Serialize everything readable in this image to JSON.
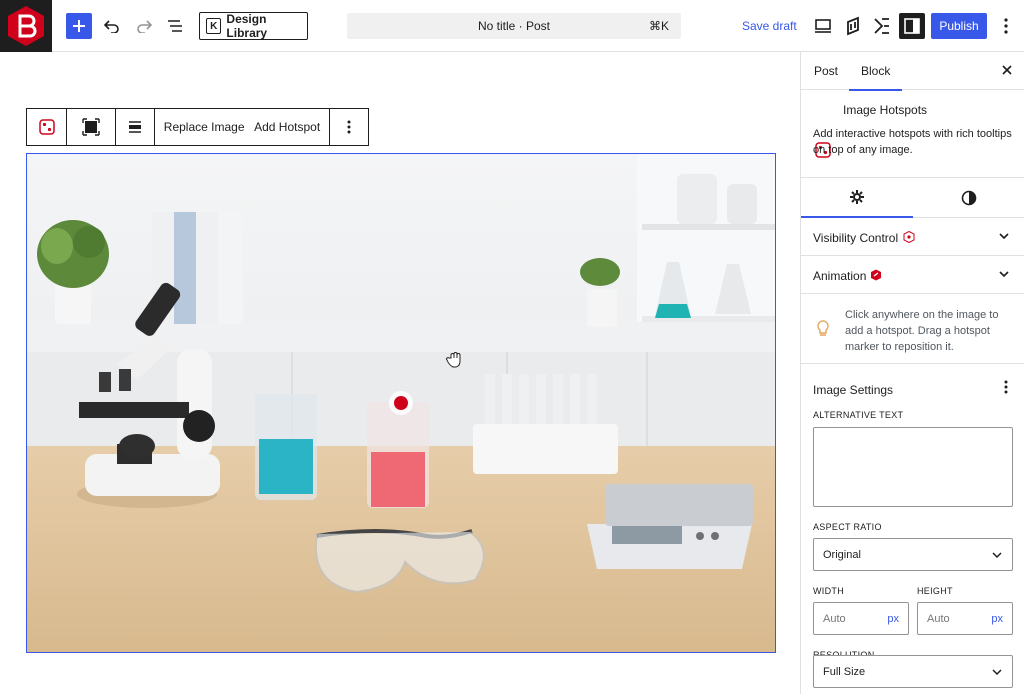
{
  "topbar": {
    "design_library_label": "Design Library",
    "document_title": "No title · Post",
    "shortcut": "⌘K",
    "save_draft_label": "Save draft",
    "publish_label": "Publish",
    "accent_color": "#3858e9"
  },
  "block_toolbar": {
    "replace_image_label": "Replace Image",
    "add_hotspot_label": "Add Hotspot"
  },
  "sidebar": {
    "tabs": [
      {
        "label": "Post",
        "active": false
      },
      {
        "label": "Block",
        "active": true
      }
    ],
    "block": {
      "name": "Image Hotspots",
      "description": "Add interactive hotspots with rich tooltips on top of any image."
    },
    "panels": {
      "visibility_label": "Visibility Control",
      "animation_label": "Animation"
    },
    "hint": "Click anywhere on the image to add a hotspot. Drag a hotspot marker to reposition it.",
    "image_settings": {
      "title": "Image Settings",
      "alt_text_label": "ALTERNATIVE TEXT",
      "alt_text_value": "",
      "aspect_ratio_label": "ASPECT RATIO",
      "aspect_ratio_value": "Original",
      "width_label": "WIDTH",
      "width_placeholder": "Auto",
      "width_unit": "px",
      "height_label": "HEIGHT",
      "height_placeholder": "Auto",
      "height_unit": "px",
      "resolution_label": "RESOLUTION",
      "resolution_value": "Full Size"
    }
  },
  "icons": [
    "plus-icon",
    "undo-icon",
    "redo-icon",
    "list-view-icon",
    "desktop-preview-icon",
    "gear-icon",
    "contrast-icon",
    "chevron-down-icon",
    "close-icon",
    "more-vertical-icon",
    "lightbulb-icon",
    "hotspot-block-icon"
  ],
  "hotspot_color": "#d0021b"
}
